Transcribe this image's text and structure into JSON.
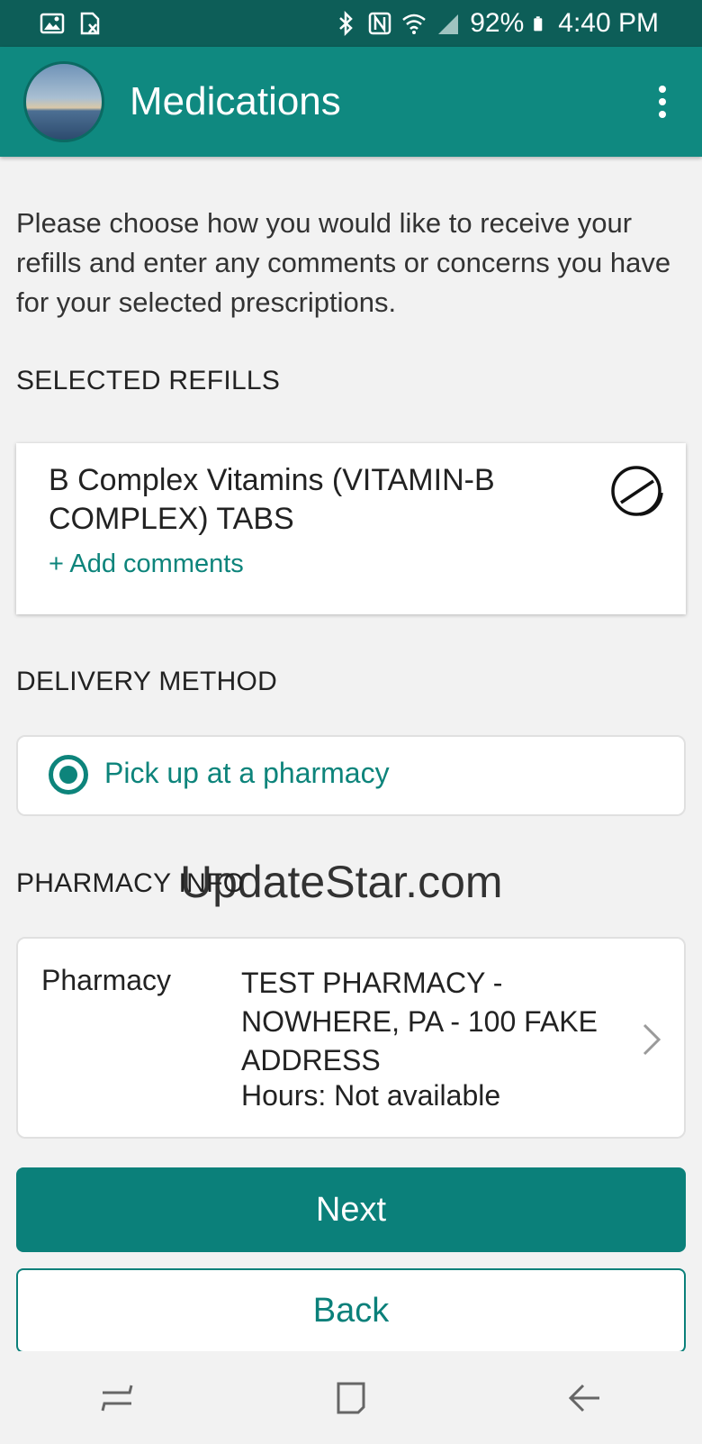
{
  "status_bar": {
    "battery": "92%",
    "time": "4:40 PM",
    "icons": [
      "gallery-icon",
      "sim-icon",
      "bluetooth-icon",
      "nfc-icon",
      "wifi-icon",
      "signal-icon",
      "battery-icon"
    ]
  },
  "app_bar": {
    "title": "Medications",
    "menu_icon": "more-vert-icon"
  },
  "intro_text": "Please choose how you would like to receive your refills and enter any comments or concerns you have for your selected prescriptions.",
  "selected_refills": {
    "heading": "SELECTED REFILLS",
    "items": [
      {
        "name": "B Complex Vitamins (VITAMIN-B COMPLEX) TABS",
        "add_comments": "+ Add comments",
        "icon": "pill-icon"
      }
    ]
  },
  "delivery_method": {
    "heading": "DELIVERY METHOD",
    "selected_option": "Pick up at a pharmacy"
  },
  "pharmacy_info": {
    "heading": "PHARMACY INFO",
    "label": "Pharmacy",
    "name": "TEST PHARMACY - NOWHERE, PA - 100 FAKE ADDRESS",
    "hours": "Hours: Not available"
  },
  "buttons": {
    "next": "Next",
    "back": "Back"
  },
  "watermark": "UpdateStar.com",
  "colors": {
    "status_bar": "#0d5e58",
    "app_bar": "#0f8980",
    "accent": "#0b807a",
    "background": "#f2f2f2"
  }
}
